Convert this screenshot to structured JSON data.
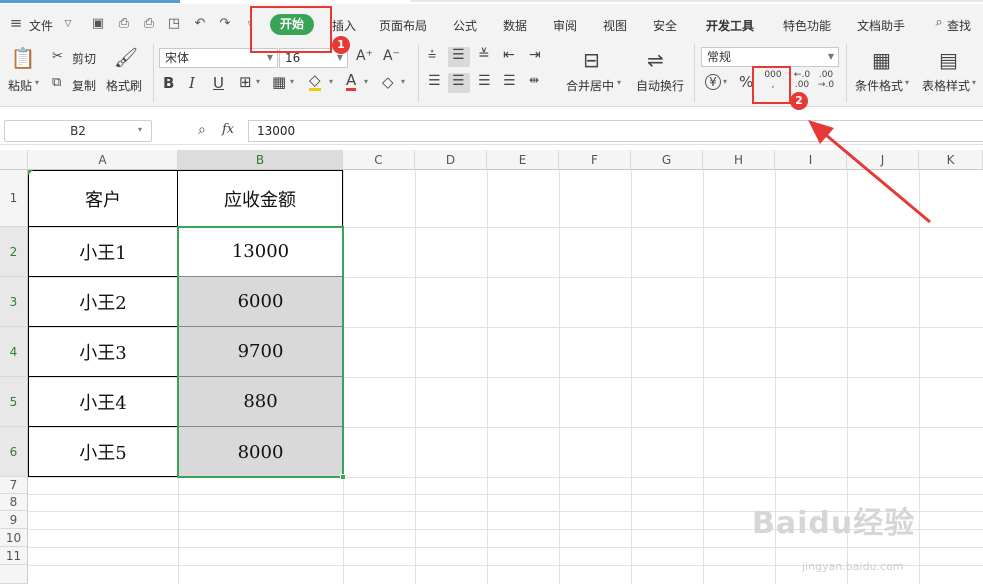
{
  "menu": {
    "file": "文件",
    "tabs": [
      "插入",
      "页面布局",
      "公式",
      "数据",
      "审阅",
      "视图",
      "安全",
      "开发工具",
      "特色功能",
      "文档助手"
    ],
    "active_tab": "开始",
    "search": "查找"
  },
  "toolbar": {
    "paste": "粘贴",
    "cut": "剪切",
    "copy": "复制",
    "format_painter": "格式刷",
    "font_name": "宋体",
    "font_size": "16",
    "merge_center": "合并居中",
    "wrap_text": "自动换行",
    "number_format": "常规",
    "thousands_icon": "000",
    "decimal_increase": ".00",
    "decimal_decrease": ".00",
    "conditional_format": "条件格式",
    "table_style": "表格样式"
  },
  "formula_bar": {
    "name_box": "B2",
    "fx": "fx",
    "value": "13000"
  },
  "sheet": {
    "columns": [
      "A",
      "B",
      "C",
      "D",
      "E",
      "F",
      "G",
      "H",
      "I",
      "J",
      "K"
    ],
    "rows": [
      "1",
      "2",
      "3",
      "4",
      "5",
      "6",
      "7",
      "8",
      "9",
      "10",
      "11"
    ],
    "header": [
      "客户",
      "应收金额"
    ],
    "data": [
      [
        "小王1",
        "13000"
      ],
      [
        "小王2",
        "6000"
      ],
      [
        "小王3",
        "9700"
      ],
      [
        "小王4",
        "880"
      ],
      [
        "小王5",
        "8000"
      ]
    ]
  },
  "annotations": {
    "badge1": "1",
    "badge2": "2",
    "colors": {
      "highlight": "#e53935",
      "accent_green": "#3aa356"
    }
  },
  "watermark": {
    "logo": "Baidu经验",
    "url": "jingyan.baidu.com"
  }
}
